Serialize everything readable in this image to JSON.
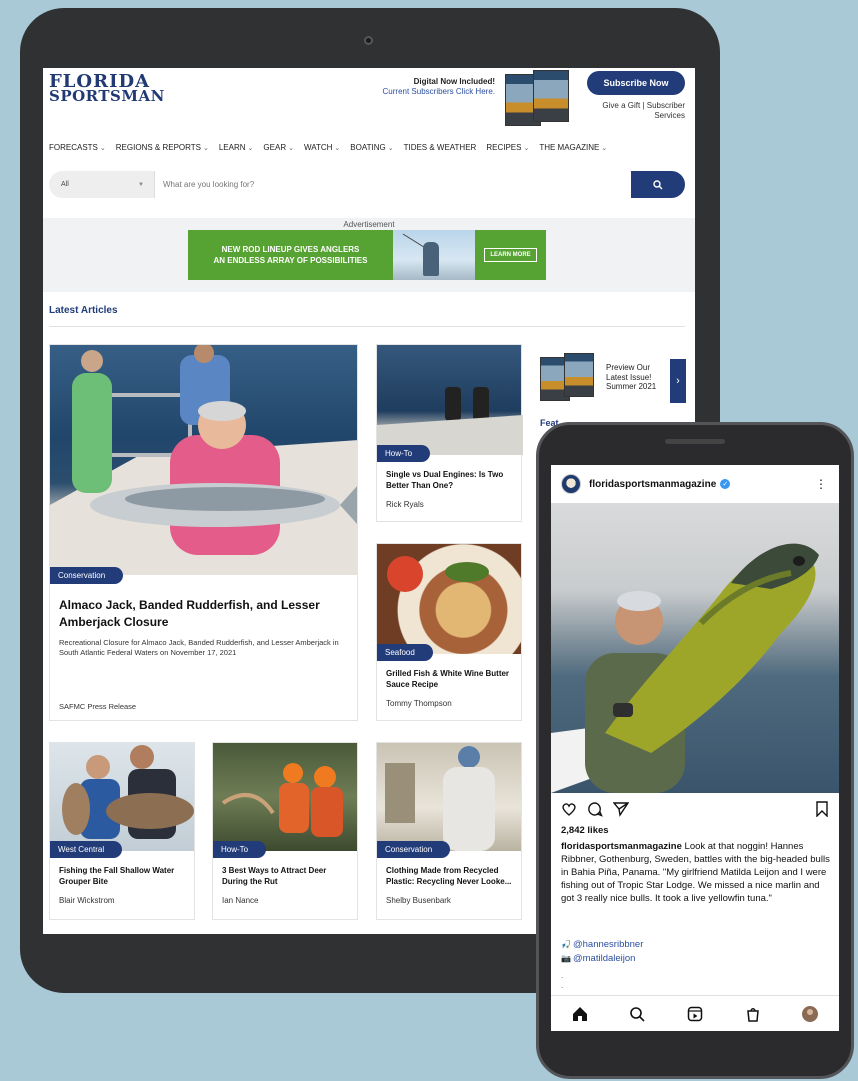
{
  "site": {
    "logo_line1": "FLORIDA",
    "logo_line2": "SPORTSMAN",
    "digital_line1": "Digital Now Included!",
    "digital_line2": "Current Subscribers Click Here.",
    "subscribe_label": "Subscribe Now",
    "gift_label": "Give a Gift |",
    "services_label_1": "Subscriber",
    "services_label_2": "Services"
  },
  "nav": [
    {
      "label": "FORECASTS",
      "chevron": true
    },
    {
      "label": "REGIONS & REPORTS",
      "chevron": true
    },
    {
      "label": "LEARN",
      "chevron": true
    },
    {
      "label": "GEAR",
      "chevron": true
    },
    {
      "label": "WATCH",
      "chevron": true
    },
    {
      "label": "BOATING",
      "chevron": true
    },
    {
      "label": "TIDES & WEATHER",
      "chevron": false
    },
    {
      "label": "RECIPES",
      "chevron": true
    },
    {
      "label": "THE MAGAZINE",
      "chevron": true
    }
  ],
  "search": {
    "category": "All",
    "placeholder": "What are you looking for?"
  },
  "ad": {
    "label": "Advertisement",
    "headline_1": "NEW ROD LINEUP GIVES ANGLERS",
    "headline_2": "AN ENDLESS ARRAY OF POSSIBILITIES",
    "cta": "LEARN MORE"
  },
  "latest": {
    "title": "Latest Articles",
    "hero": {
      "tag": "Conservation",
      "title": "Almaco Jack, Banded Rudderfish, and Lesser Amberjack Closure",
      "dek": "Recreational Closure for Almaco Jack, Banded Rudderfish, and Lesser Amberjack in South Atlantic Federal Waters on November 17, 2021",
      "author": "SAFMC Press Release"
    },
    "cards": [
      {
        "tag": "How-To",
        "title": "Single vs Dual Engines: Is Two Better Than One?",
        "author": "Rick Ryals"
      },
      {
        "tag": "Seafood",
        "title": "Grilled Fish & White Wine Butter Sauce Recipe",
        "author": "Tommy Thompson"
      },
      {
        "tag": "West Central",
        "title": "Fishing the Fall Shallow Water Grouper Bite",
        "author": "Blair Wickstrom"
      },
      {
        "tag": "How-To",
        "title": "3 Best Ways to Attract Deer During the Rut",
        "author": "Ian Nance"
      },
      {
        "tag": "Conservation",
        "title": "Clothing Made from Recycled Plastic: Recycling Never Looke...",
        "author": "Shelby Busenbark"
      }
    ]
  },
  "sidebar": {
    "preview_1": "Preview Our",
    "preview_2": "Latest Issue!",
    "preview_3": "Summer 2021",
    "featured_peek": "Feat"
  },
  "instagram": {
    "username": "floridasportsmanmagazine",
    "likes": "2,842 likes",
    "caption_user": "floridasportsmanmagazine",
    "caption_text": " Look at that noggin! Hannes Ribbner, Gothenburg, Sweden, battles with the big-headed bulls in Bahia Piña, Panama. \"My girlfriend Matilda Leijon and I were fishing out of Tropic Star Lodge. We missed a nice marlin and got 3 really nice bulls. It took a live yellowfin tuna.\"",
    "tag_1": "@hannesribbner",
    "tag_2": "@matildaleijon",
    "dot_1": ".",
    "dot_2": "."
  },
  "colors": {
    "brand_blue": "#223c7a",
    "ad_green": "#56a232",
    "background": "#a9c9d6"
  }
}
